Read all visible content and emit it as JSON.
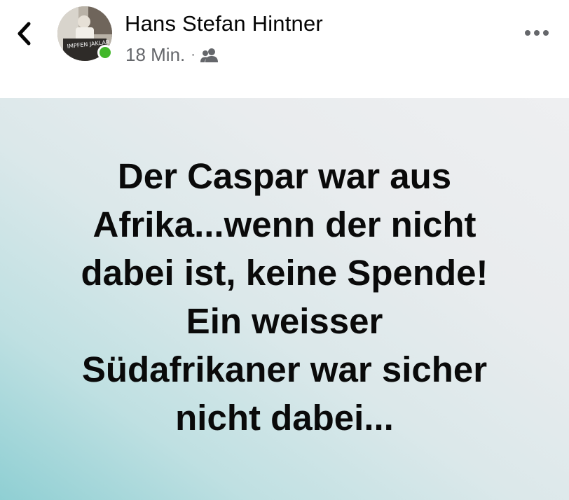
{
  "header": {
    "back_icon": "chevron-left-icon",
    "author_name": "Hans Stefan Hintner",
    "timestamp": "18 Min.",
    "separator": "·",
    "audience_icon": "friends-icon",
    "more_icon": "more-horizontal-icon",
    "avatar_caption": "IMPFEN JAKLAR",
    "online_color": "#42b72a"
  },
  "post": {
    "lines": [
      "Der Caspar war aus",
      "Afrika...wenn der nicht",
      "dabei ist, keine Spende!",
      "Ein weisser",
      "Südafrikaner war sicher",
      "nicht dabei..."
    ],
    "background_colors": [
      "#8fcfd3",
      "#eeeff1"
    ]
  }
}
